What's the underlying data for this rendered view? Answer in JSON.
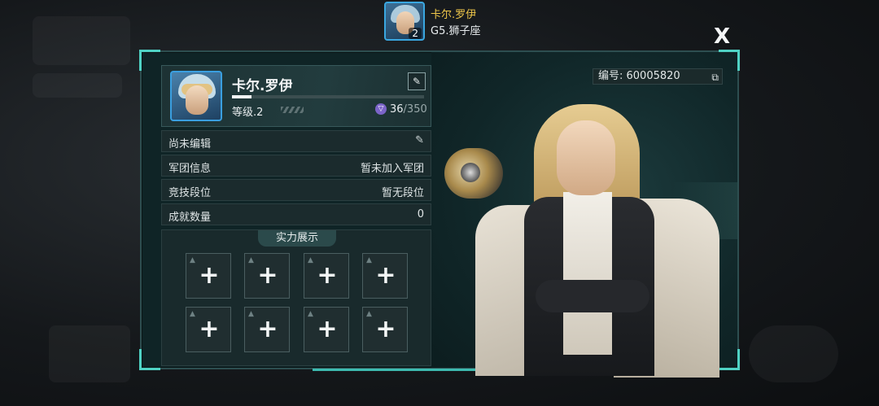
{
  "header": {
    "player_name": "卡尔.罗伊",
    "subtitle": "G5.狮子座",
    "avatar_level": "2",
    "close_label": "X"
  },
  "profile": {
    "name": "卡尔.罗伊",
    "level_label": "等级.2",
    "exp_current": "36",
    "exp_total": "/350",
    "exp_fraction": 0.103
  },
  "info_rows": [
    {
      "label": "尚未编辑",
      "value": ""
    },
    {
      "label": "军团信息",
      "value": "暂未加入军团"
    },
    {
      "label": "竞技段位",
      "value": "暂无段位"
    },
    {
      "label": "成就数量",
      "value": "0"
    }
  ],
  "showcase": {
    "title": "实力展示",
    "slots": [
      "+",
      "+",
      "+",
      "+",
      "+",
      "+",
      "+",
      "+"
    ]
  },
  "id_badge": {
    "text": "编号: 60005820"
  },
  "colors": {
    "accent_teal": "#4fd2c4",
    "name_gold": "#f0c84a",
    "avatar_border": "#3a9fe0"
  },
  "icons": [
    "edit-icon",
    "pencil-icon",
    "exp-gem-icon",
    "copy-icon",
    "close-icon",
    "plus-icon",
    "triangle-icon"
  ]
}
